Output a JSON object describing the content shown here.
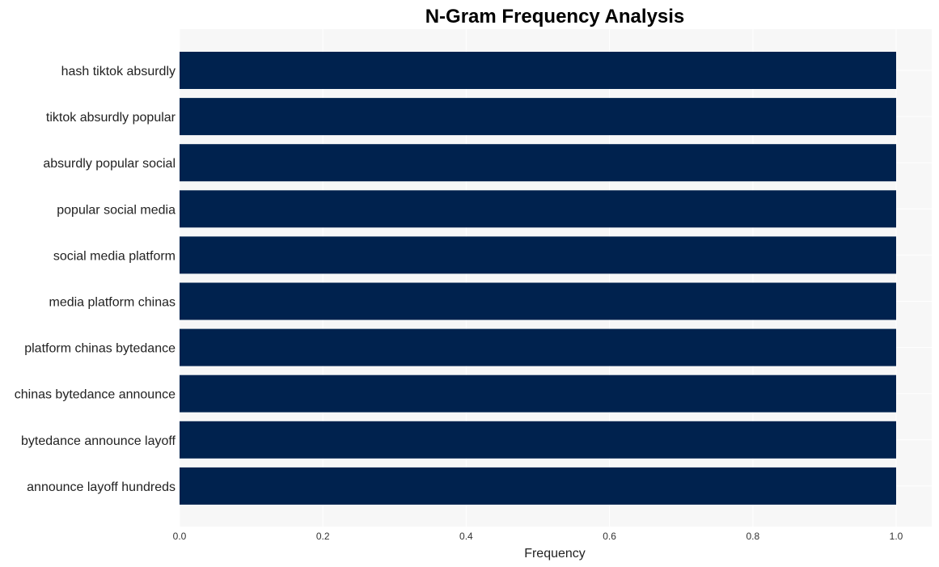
{
  "chart_data": {
    "type": "bar",
    "orientation": "horizontal",
    "title": "N-Gram Frequency Analysis",
    "xlabel": "Frequency",
    "ylabel": "",
    "categories": [
      "hash tiktok absurdly",
      "tiktok absurdly popular",
      "absurdly popular social",
      "popular social media",
      "social media platform",
      "media platform chinas",
      "platform chinas bytedance",
      "chinas bytedance announce",
      "bytedance announce layoff",
      "announce layoff hundreds"
    ],
    "values": [
      1,
      1,
      1,
      1,
      1,
      1,
      1,
      1,
      1,
      1
    ],
    "xlim": [
      0,
      1.05
    ],
    "xticks": [
      "0.0",
      "0.2",
      "0.4",
      "0.6",
      "0.8",
      "1.0"
    ],
    "grid": true,
    "legend": "none",
    "colors": {
      "bar": "#00224e",
      "plot_background": "#f7f7f7",
      "grid": "#ffffff"
    }
  }
}
